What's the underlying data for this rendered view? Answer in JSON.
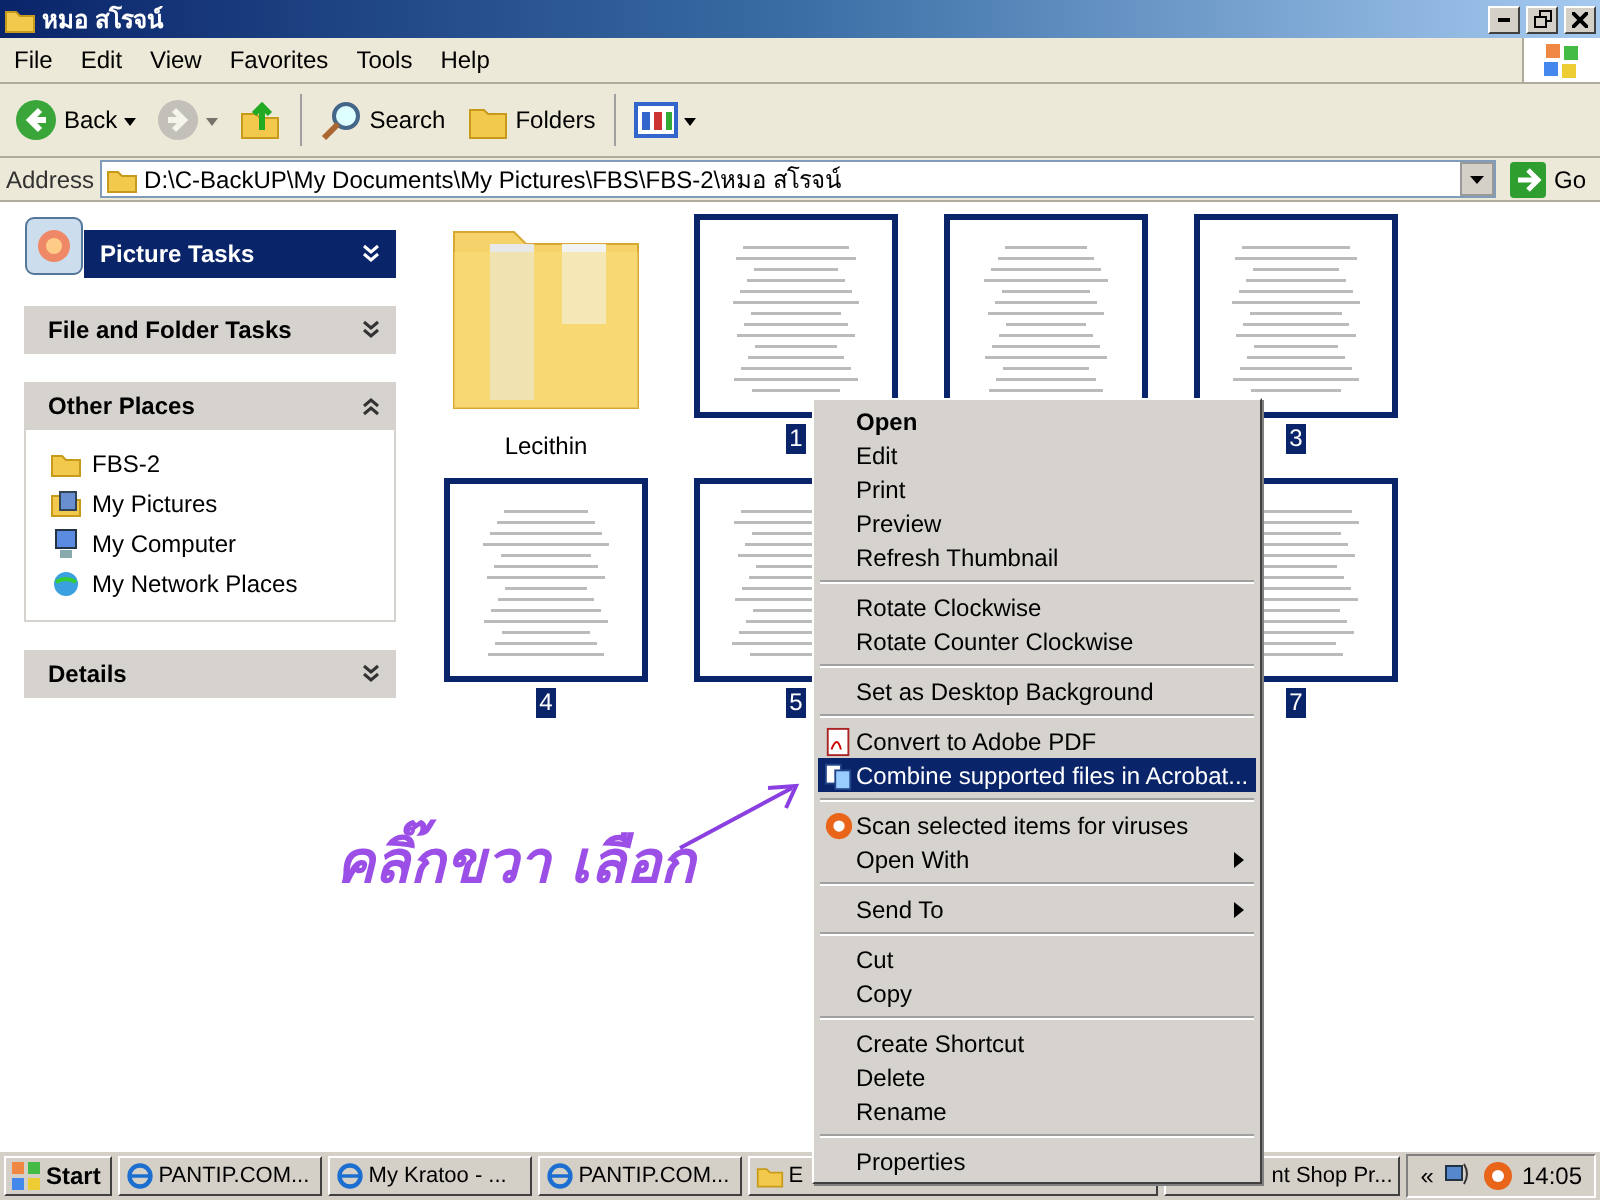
{
  "window": {
    "title": "หมอ สโรจน์"
  },
  "menu_bar": [
    "File",
    "Edit",
    "View",
    "Favorites",
    "Tools",
    "Help"
  ],
  "toolbar": [
    {
      "kind": "back",
      "label": "Back",
      "disabled": false
    },
    {
      "kind": "forward",
      "disabled": true
    },
    {
      "kind": "up",
      "disabled": false
    },
    {
      "kind": "search",
      "label": "Search",
      "disabled": false
    },
    {
      "kind": "folders",
      "label": "Folders",
      "disabled": false
    },
    {
      "kind": "views",
      "disabled": false
    }
  ],
  "address": {
    "label": "Address",
    "value": "D:\\C-BackUP\\My Documents\\My Pictures\\FBS\\FBS-2\\หมอ สโรจน์",
    "go": "Go"
  },
  "sidebar": [
    {
      "title": "Picture Tasks",
      "kind": "special",
      "expanded": false
    },
    {
      "title": "File and Folder Tasks",
      "kind": "normal",
      "expanded": false
    },
    {
      "title": "Other Places",
      "kind": "normal",
      "expanded": true,
      "items": [
        {
          "label": "FBS-2",
          "kind": "folder"
        },
        {
          "label": "My Pictures",
          "kind": "pictures"
        },
        {
          "label": "My Computer",
          "kind": "computer"
        },
        {
          "label": "My Network Places",
          "kind": "network"
        }
      ]
    },
    {
      "title": "Details",
      "kind": "normal",
      "expanded": false
    }
  ],
  "files": [
    {
      "kind": "folder",
      "label": "Lecithin",
      "selected": false
    },
    {
      "kind": "image",
      "label": "1",
      "selected": true
    },
    {
      "kind": "image",
      "selected": true
    },
    {
      "kind": "image",
      "label": "3",
      "selected": true
    },
    {
      "kind": "image",
      "label": "4",
      "selected": true
    },
    {
      "kind": "image",
      "label": "5",
      "selected": true
    },
    {
      "kind": "image"
    },
    {
      "kind": "image",
      "label": "7",
      "selected": true
    }
  ],
  "context_menu": {
    "groups": [
      [
        {
          "label": "Open",
          "kind": "default",
          "selected": false
        },
        {
          "label": "Edit",
          "kind": "plain",
          "selected": false
        },
        {
          "label": "Print",
          "kind": "plain",
          "selected": false
        },
        {
          "label": "Preview",
          "kind": "plain",
          "selected": false
        },
        {
          "label": "Refresh Thumbnail",
          "kind": "plain",
          "selected": false
        }
      ],
      [
        {
          "label": "Rotate Clockwise",
          "kind": "plain",
          "selected": false
        },
        {
          "label": "Rotate Counter Clockwise",
          "kind": "plain",
          "selected": false
        }
      ],
      [
        {
          "label": "Set as Desktop Background",
          "kind": "plain",
          "selected": false
        }
      ],
      [
        {
          "label": "Convert to Adobe PDF",
          "kind": "pdf",
          "selected": false
        },
        {
          "label": "Combine supported files in Acrobat...",
          "kind": "combine",
          "selected": true
        }
      ],
      [
        {
          "label": "Scan selected items for viruses",
          "kind": "antivirus",
          "selected": false
        },
        {
          "label": "Open With",
          "kind": "submenu",
          "selected": false
        }
      ],
      [
        {
          "label": "Send To",
          "kind": "submenu",
          "selected": false
        }
      ],
      [
        {
          "label": "Cut",
          "kind": "plain",
          "selected": false
        },
        {
          "label": "Copy",
          "kind": "plain",
          "selected": false
        }
      ],
      [
        {
          "label": "Create Shortcut",
          "kind": "plain",
          "selected": false
        },
        {
          "label": "Delete",
          "kind": "plain",
          "selected": false
        },
        {
          "label": "Rename",
          "kind": "plain",
          "selected": false
        }
      ],
      [
        {
          "label": "Properties",
          "kind": "plain",
          "selected": false
        }
      ]
    ]
  },
  "annotation": {
    "text": "คลิ๊กขวา เลือก"
  },
  "taskbar": {
    "start": "Start",
    "buttons": [
      {
        "label": "PANTIP.COM...",
        "kind": "browser"
      },
      {
        "label": "My Kratoo - ...",
        "kind": "browser"
      },
      {
        "label": "PANTIP.COM...",
        "kind": "browser"
      },
      {
        "label": "E",
        "kind": "folder"
      },
      {
        "label": "nt Shop Pr...",
        "kind": "other"
      }
    ],
    "tray_toggle": "«",
    "clock": "14:05"
  }
}
